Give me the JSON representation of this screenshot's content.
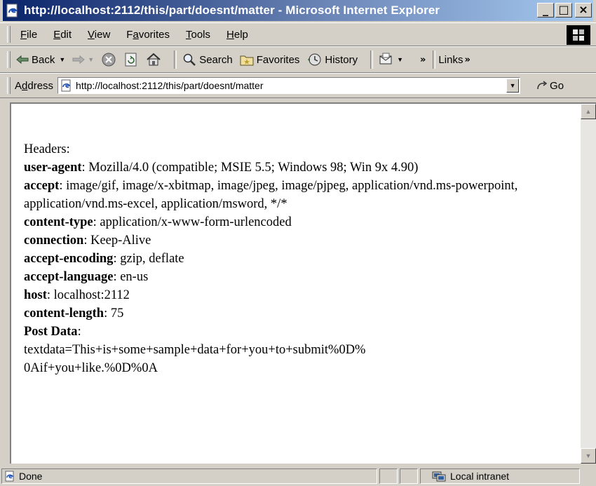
{
  "window": {
    "title": "http://localhost:2112/this/part/doesnt/matter - Microsoft Internet Explorer",
    "minimize": "_",
    "maximize": "□",
    "close": "×"
  },
  "menu": {
    "items": [
      {
        "label": "File",
        "accel": "F"
      },
      {
        "label": "Edit",
        "accel": "E"
      },
      {
        "label": "View",
        "accel": "V"
      },
      {
        "label": "Favorites",
        "accel": "a"
      },
      {
        "label": "Tools",
        "accel": "T"
      },
      {
        "label": "Help",
        "accel": "H"
      }
    ]
  },
  "toolbar": {
    "back": "Back",
    "search": "Search",
    "favorites": "Favorites",
    "history": "History",
    "links": "Links",
    "more": "»"
  },
  "address": {
    "label": "Address",
    "url": "http://localhost:2112/this/part/doesnt/matter",
    "go": "Go"
  },
  "page": {
    "heading": "Headers:",
    "headers": [
      {
        "name": "user-agent",
        "value": ": Mozilla/4.0 (compatible; MSIE 5.5; Windows 98; Win 9x 4.90)"
      },
      {
        "name": "accept",
        "value": ": image/gif, image/x-xbitmap, image/jpeg, image/pjpeg, application/vnd.ms-powerpoint, application/vnd.ms-excel, application/msword, */*"
      },
      {
        "name": "content-type",
        "value": ": application/x-www-form-urlencoded"
      },
      {
        "name": "connection",
        "value": ": Keep-Alive"
      },
      {
        "name": "accept-encoding",
        "value": ": gzip, deflate"
      },
      {
        "name": "accept-language",
        "value": ": en-us"
      },
      {
        "name": "host",
        "value": ": localhost:2112"
      },
      {
        "name": "content-length",
        "value": ": 75"
      }
    ],
    "post_label": "Post Data",
    "post_colon": ":",
    "post_line1": "textdata=This+is+some+sample+data+for+you+to+submit%0D%",
    "post_line2": "0Aif+you+like.%0D%0A"
  },
  "status": {
    "text": "Done",
    "zone": "Local intranet"
  }
}
